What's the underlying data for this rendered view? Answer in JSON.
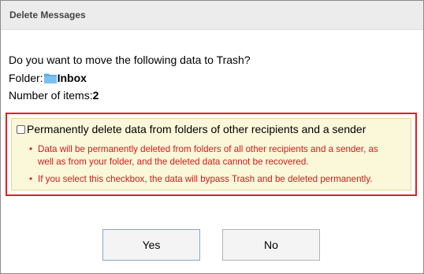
{
  "dialog": {
    "title": "Delete Messages",
    "question": "Do you want to move the following data to Trash?",
    "folder_label": "Folder:",
    "folder_name": "Inbox",
    "items_label": "Number of items:",
    "items_count": "2"
  },
  "warning": {
    "checkbox_label": "Permanently delete data from folders of other recipients and a sender",
    "checked": false,
    "bullet_1_line_1": "Data will be permanently deleted from folders of all other recipients and a sender, as",
    "bullet_1_line_2": "well as from your folder, and the deleted data cannot be recovered.",
    "bullet_2": "If you select this checkbox, the data will bypass Trash and be deleted permanently.",
    "bullet_symbol": "•"
  },
  "buttons": {
    "yes_label": "Yes",
    "no_label": "No"
  },
  "icons": {
    "folder": "folder-icon"
  },
  "colors": {
    "warning_text": "#d11a1a",
    "warning_border": "#e02020",
    "warning_background": "#fbf7d9",
    "folder_icon": "#5aa9e6"
  }
}
